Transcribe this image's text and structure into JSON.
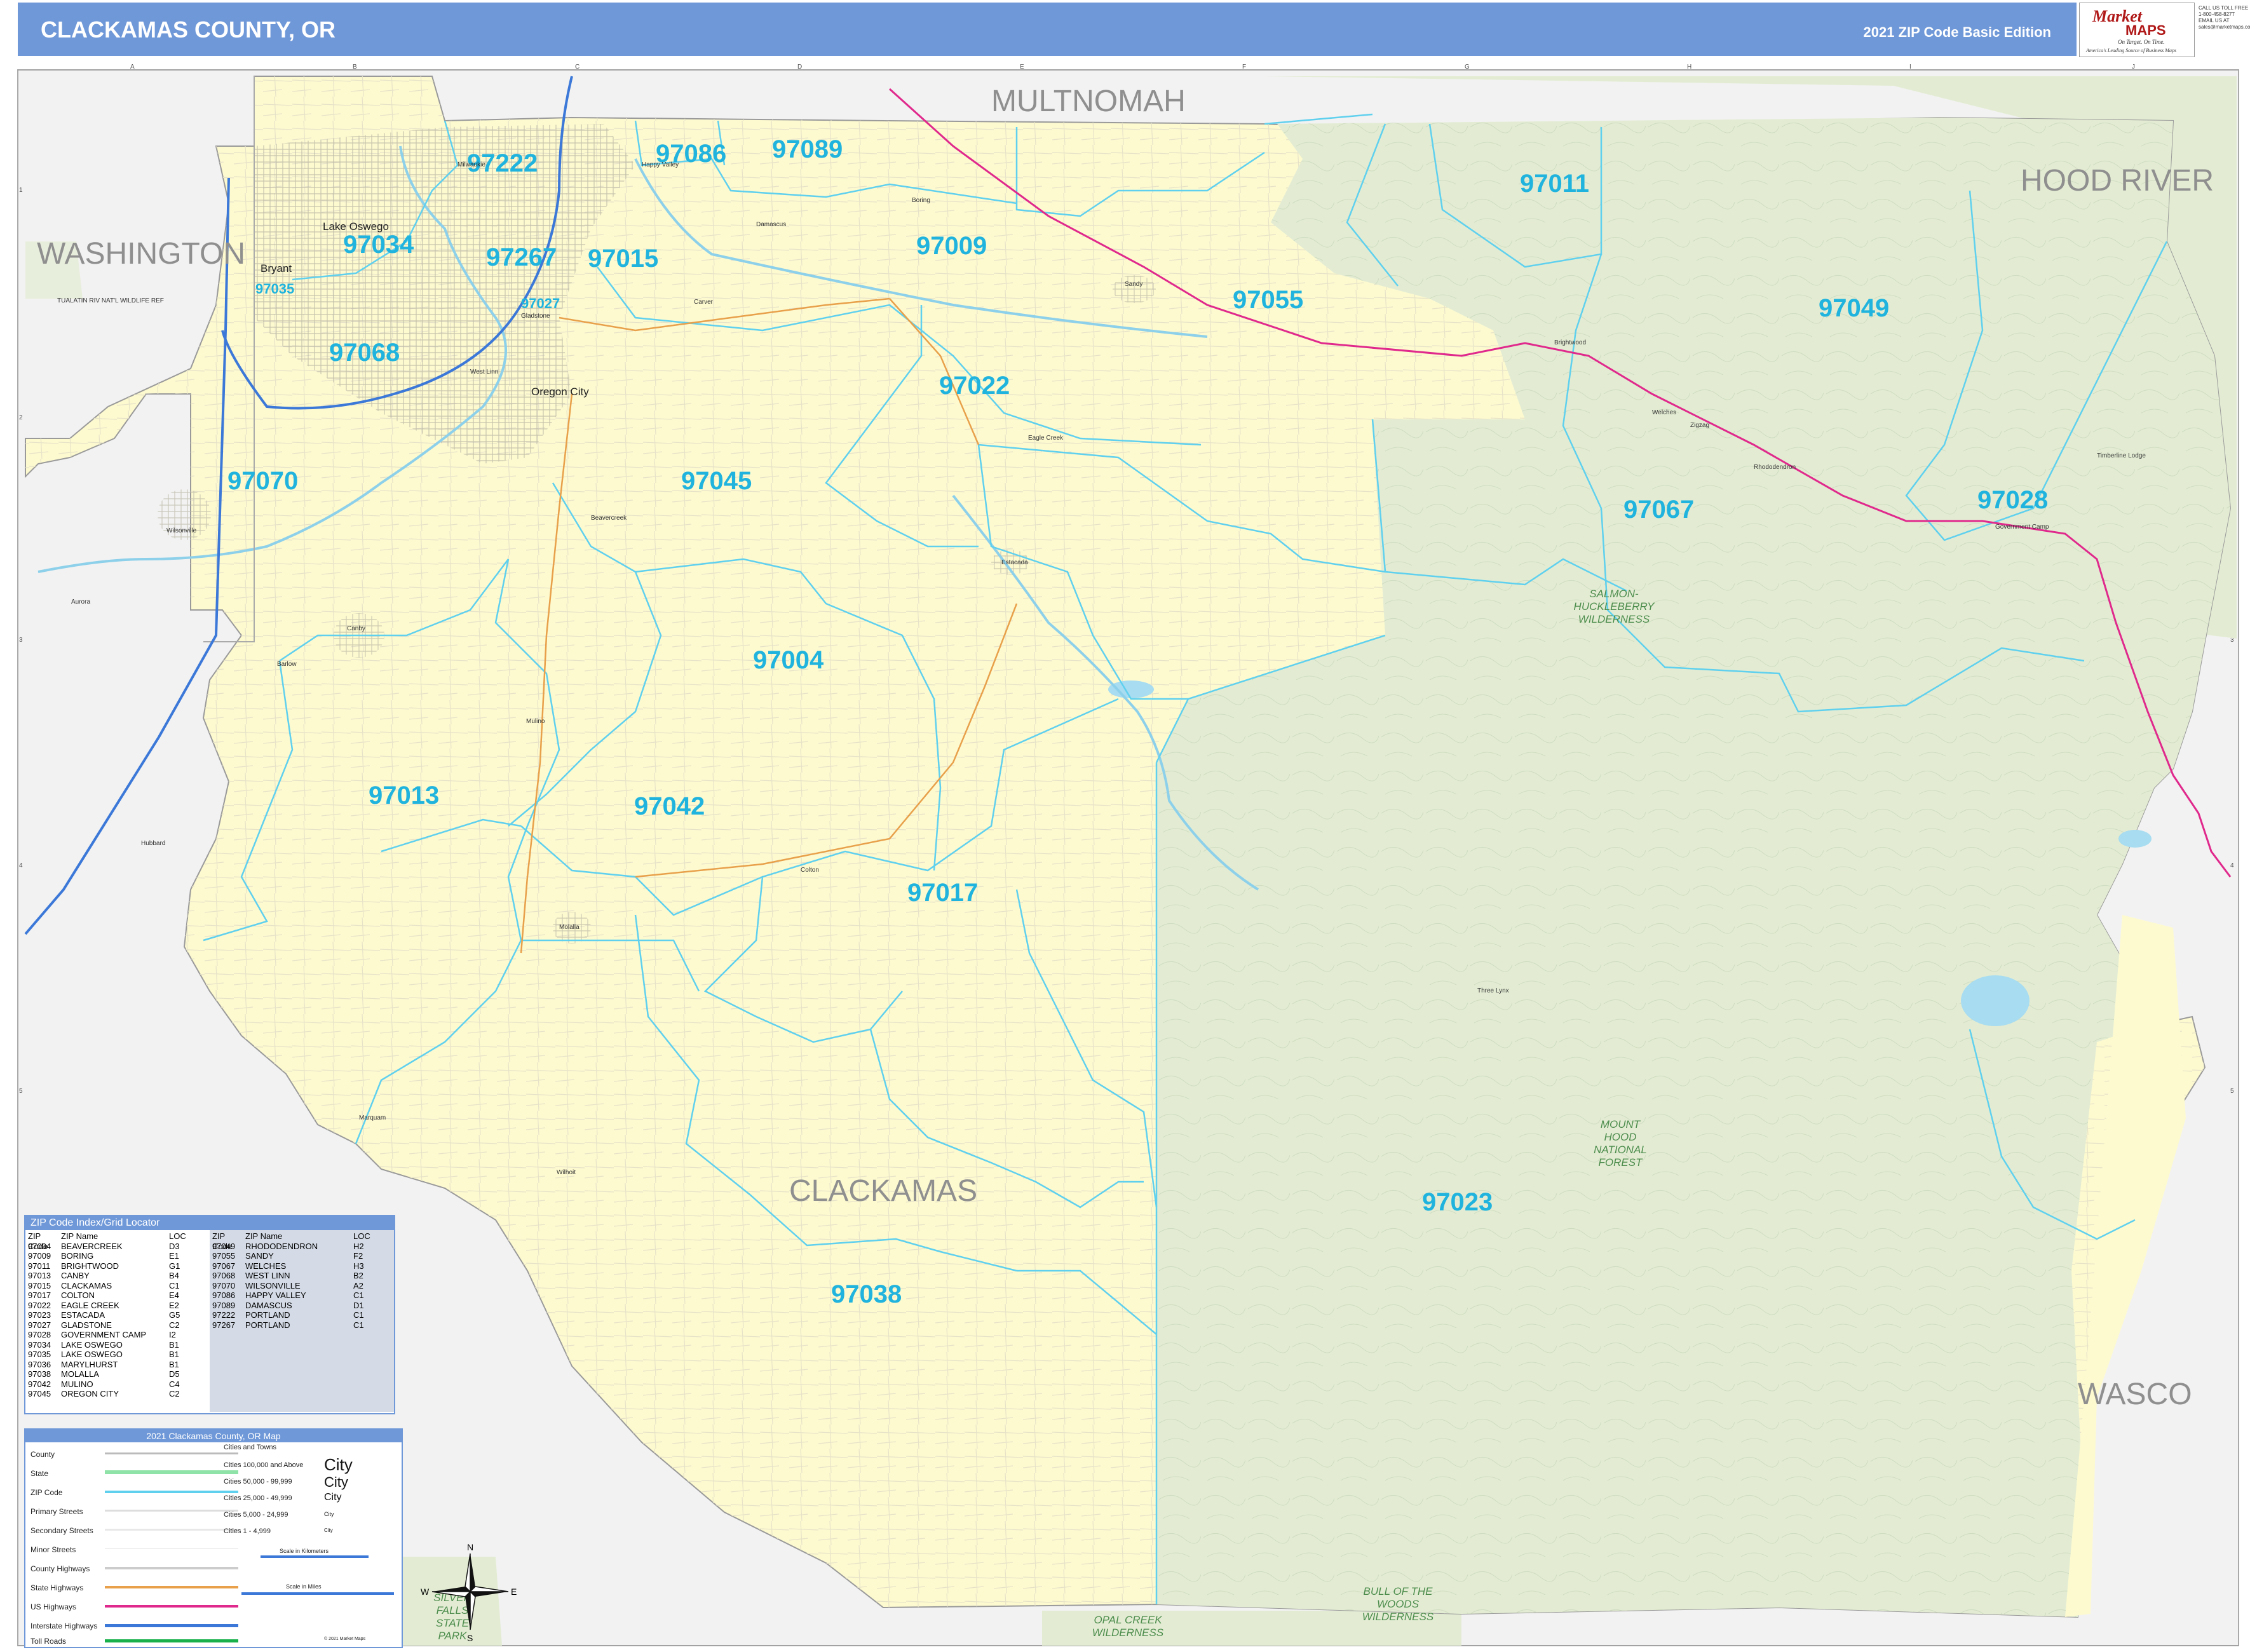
{
  "header": {
    "title": "CLACKAMAS COUNTY, OR",
    "edition": "2021 ZIP Code Basic Edition"
  },
  "logo": {
    "name_part1": "Market",
    "name_part2": "MAPS",
    "tagline": "On Target. On Time.",
    "tagline2": "America's Leading Source of Business Maps",
    "contact": [
      "CALL US TOLL FREE",
      "1-800-458-8277",
      "EMAIL US AT",
      "sales@marketmaps.com"
    ]
  },
  "grid": {
    "columns": [
      "A",
      "B",
      "C",
      "D",
      "E",
      "F",
      "G",
      "H",
      "I",
      "J"
    ],
    "rows": [
      "1",
      "2",
      "3",
      "4",
      "5"
    ]
  },
  "counties": {
    "multnomah": "MULTNOMAH",
    "hood_river": "HOOD RIVER",
    "washington": "WASHINGTON",
    "clackamas": "CLACKAMAS",
    "wasco": "WASCO"
  },
  "zip_labels": [
    "97222",
    "97086",
    "97089",
    "97011",
    "97034",
    "97267",
    "97015",
    "97009",
    "97055",
    "97049",
    "97068",
    "97022",
    "97070",
    "97045",
    "97067",
    "97028",
    "97004",
    "97013",
    "97042",
    "97017",
    "97023",
    "97038",
    "97035",
    "97027"
  ],
  "cities": {
    "lake_oswego": "Lake Oswego",
    "oregon_city": "Oregon City",
    "bryant": "Bryant",
    "west_linn": "West Linn",
    "milwaukie": "Milwaukie",
    "happy_valley": "Happy Valley",
    "gladstone": "Gladstone",
    "wilsonville": "Wilsonville",
    "canby": "Canby",
    "molalla": "Molalla",
    "estacada": "Estacada",
    "sandy": "Sandy",
    "boring": "Boring",
    "damascus": "Damascus",
    "welches": "Welches",
    "rhododendron": "Rhododendron",
    "government_camp": "Government Camp",
    "timberline_lodge": "Timberline Lodge",
    "colton": "Colton",
    "mulino": "Mulino",
    "beavercreek": "Beavercreek",
    "three_lynx": "Three Lynx",
    "marquam": "Marquam",
    "wilhoit": "Wilhoit",
    "hubbard": "Hubbard",
    "aurora": "Aurora",
    "barlow": "Barlow",
    "carver": "Carver",
    "eagle_creek": "Eagle Creek",
    "brightwood": "Brightwood",
    "zigzag": "Zigzag",
    "tualatin_refuge": "TUALATIN RIV NAT'L WILDLIFE REF"
  },
  "wilderness": {
    "salmon": [
      "SALMON-",
      "HUCKLEBERRY",
      "WILDERNESS"
    ],
    "mount_hood": [
      "MOUNT",
      "HOOD",
      "NATIONAL",
      "FOREST"
    ],
    "bull_woods": [
      "BULL OF THE",
      "WOODS",
      "WILDERNESS"
    ],
    "opal_creek": [
      "OPAL CREEK",
      "WILDERNESS"
    ],
    "silver_falls": [
      "SILVER",
      "FALLS",
      "STATE",
      "PARK"
    ]
  },
  "compass": {
    "n": "N",
    "s": "S",
    "e": "E",
    "w": "W"
  },
  "index": {
    "title": "ZIP Code Index/Grid Locator",
    "headers": [
      "ZIP Code",
      "ZIP Name",
      "LOC"
    ],
    "col1": [
      [
        "97004",
        "BEAVERCREEK",
        "D3"
      ],
      [
        "97009",
        "BORING",
        "E1"
      ],
      [
        "97011",
        "BRIGHTWOOD",
        "G1"
      ],
      [
        "97013",
        "CANBY",
        "B4"
      ],
      [
        "97015",
        "CLACKAMAS",
        "C1"
      ],
      [
        "97017",
        "COLTON",
        "E4"
      ],
      [
        "97022",
        "EAGLE CREEK",
        "E2"
      ],
      [
        "97023",
        "ESTACADA",
        "G5"
      ],
      [
        "97027",
        "GLADSTONE",
        "C2"
      ],
      [
        "97028",
        "GOVERNMENT CAMP",
        "I2"
      ],
      [
        "97034",
        "LAKE OSWEGO",
        "B1"
      ],
      [
        "97035",
        "LAKE OSWEGO",
        "B1"
      ],
      [
        "97036",
        "MARYLHURST",
        "B1"
      ],
      [
        "97038",
        "MOLALLA",
        "D5"
      ],
      [
        "97042",
        "MULINO",
        "C4"
      ],
      [
        "97045",
        "OREGON CITY",
        "C2"
      ]
    ],
    "col2": [
      [
        "97049",
        "RHODODENDRON",
        "H2"
      ],
      [
        "97055",
        "SANDY",
        "F2"
      ],
      [
        "97067",
        "WELCHES",
        "H3"
      ],
      [
        "97068",
        "WEST LINN",
        "B2"
      ],
      [
        "97070",
        "WILSONVILLE",
        "A2"
      ],
      [
        "97086",
        "HAPPY VALLEY",
        "C1"
      ],
      [
        "97089",
        "DAMASCUS",
        "D1"
      ],
      [
        "97222",
        "PORTLAND",
        "C1"
      ],
      [
        "97267",
        "PORTLAND",
        "C1"
      ]
    ]
  },
  "legend": {
    "title": "2021 Clackamas County, OR Map",
    "items": [
      "County",
      "State",
      "ZIP Code",
      "Primary Streets",
      "Secondary Streets",
      "Minor Streets",
      "County Highways",
      "State Highways",
      "US Highways",
      "Interstate Highways",
      "Toll Roads"
    ],
    "colors": {
      "county": "#bbbbbb",
      "state": "#8fe3a8",
      "zip": "#5fd0ee",
      "primary": "#dddddd",
      "secondary": "#e8e8e8",
      "minor": "#f0f0f0",
      "county_hwy": "#cccccc",
      "state_hwy": "#e8a04a",
      "us_hwy": "#e0298c",
      "interstate": "#3b78d8",
      "toll": "#18b04a"
    },
    "cities_header": "Cities and Towns",
    "city_classes": [
      "Cities 100,000 and Above",
      "Cities 50,000 - 99,999",
      "Cities 25,000 - 49,999",
      "Cities 5,000 - 24,999",
      "Cities 1 - 4,999"
    ],
    "city_samples": [
      "City",
      "City",
      "City",
      "City",
      "City"
    ],
    "scale_km": "Scale in Kilometers",
    "scale_mi": "Scale in Miles",
    "copyright": "© 2021 Market Maps"
  },
  "colors": {
    "header": "#6f98d8",
    "county_fill": "#fdfad0",
    "forest_fill": "#e3ecd3",
    "outside_fill": "#f2f2f2",
    "zip_line": "#5fd0ee",
    "zip_text": "#1fb3dd"
  }
}
